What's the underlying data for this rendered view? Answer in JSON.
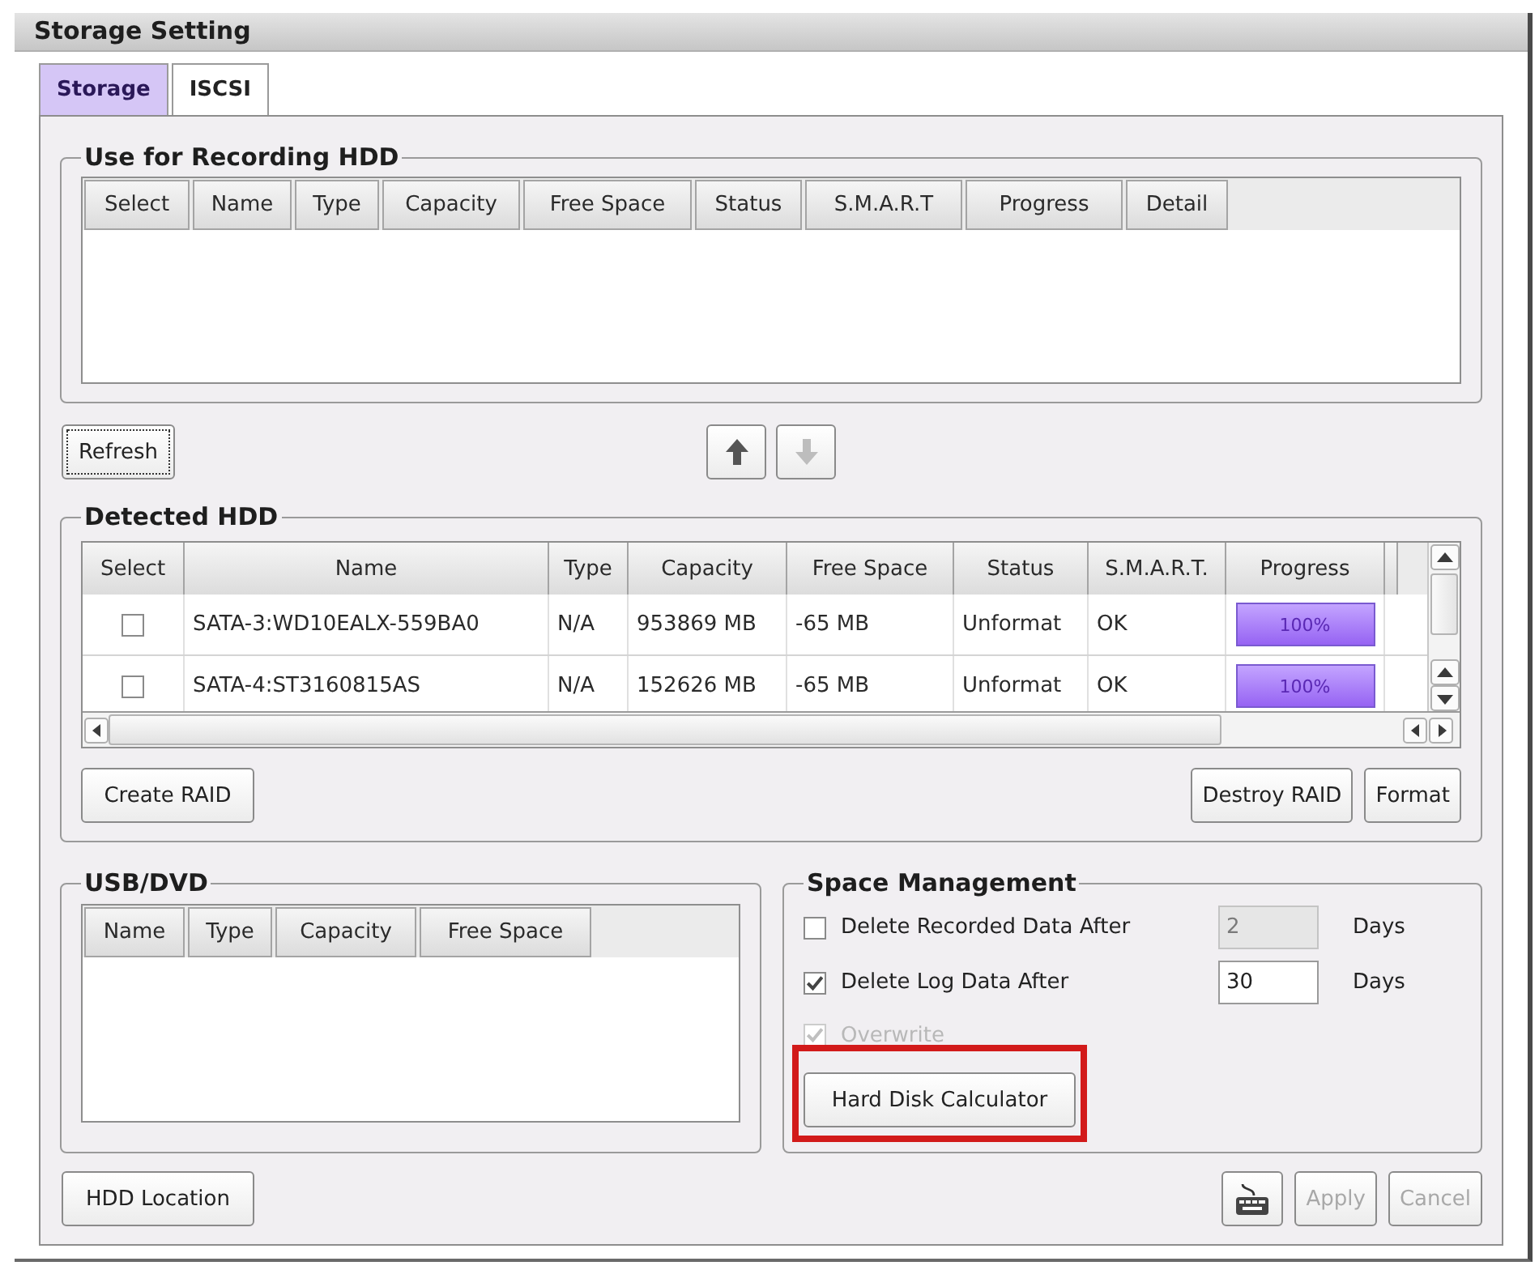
{
  "window": {
    "title": "Storage Setting"
  },
  "tabs": [
    {
      "label": "Storage",
      "selected": true
    },
    {
      "label": "ISCSI",
      "selected": false
    }
  ],
  "recording_hdd": {
    "title": "Use for Recording HDD",
    "columns": [
      "Select",
      "Name",
      "Type",
      "Capacity",
      "Free Space",
      "Status",
      "S.M.A.R.T",
      "Progress",
      "Detail"
    ]
  },
  "refresh_button": {
    "label": "Refresh",
    "focused": true
  },
  "move_buttons": [
    {
      "kind": "up",
      "disabled": false
    },
    {
      "kind": "down",
      "disabled": true
    }
  ],
  "detected_hdd": {
    "title": "Detected HDD",
    "columns": [
      "Select",
      "Name",
      "Type",
      "Capacity",
      "Free Space",
      "Status",
      "S.M.A.R.T.",
      "Progress"
    ],
    "rows": [
      {
        "checked": false,
        "name": "SATA-3:WD10EALX-559BA0",
        "type": "N/A",
        "capacity": "953869 MB",
        "free_space": "-65 MB",
        "status": "Unformat",
        "smart": "OK",
        "progress": {
          "label": "100%",
          "level": 1
        }
      },
      {
        "checked": false,
        "name": "SATA-4:ST3160815AS",
        "type": "N/A",
        "capacity": "152626 MB",
        "free_space": "-65 MB",
        "status": "Unformat",
        "smart": "OK",
        "progress": {
          "label": "100%",
          "level": 1
        }
      }
    ],
    "left_buttons": [
      "Create RAID"
    ],
    "right_buttons": [
      "Destroy RAID",
      "Format"
    ]
  },
  "usb_dvd": {
    "title": "USB/DVD",
    "columns": [
      "Name",
      "Type",
      "Capacity",
      "Free Space"
    ]
  },
  "space_management": {
    "title": "Space Management",
    "options": [
      {
        "kind": "days",
        "label": "Delete Recorded Data After",
        "checked": false,
        "disabled": false,
        "value": "2",
        "unit": "Days"
      },
      {
        "kind": "days",
        "label": "Delete Log Data After",
        "checked": true,
        "disabled": false,
        "value": "30",
        "unit": "Days"
      },
      {
        "kind": "check",
        "label": "Overwrite",
        "checked": true,
        "disabled": true
      }
    ],
    "calculator_button": {
      "label": "Hard Disk Calculator",
      "highlighted": true
    }
  },
  "footer": {
    "location_button": "HDD Location",
    "buttons": [
      {
        "label": "Apply",
        "disabled": true
      },
      {
        "label": "Cancel",
        "disabled": true
      }
    ]
  }
}
